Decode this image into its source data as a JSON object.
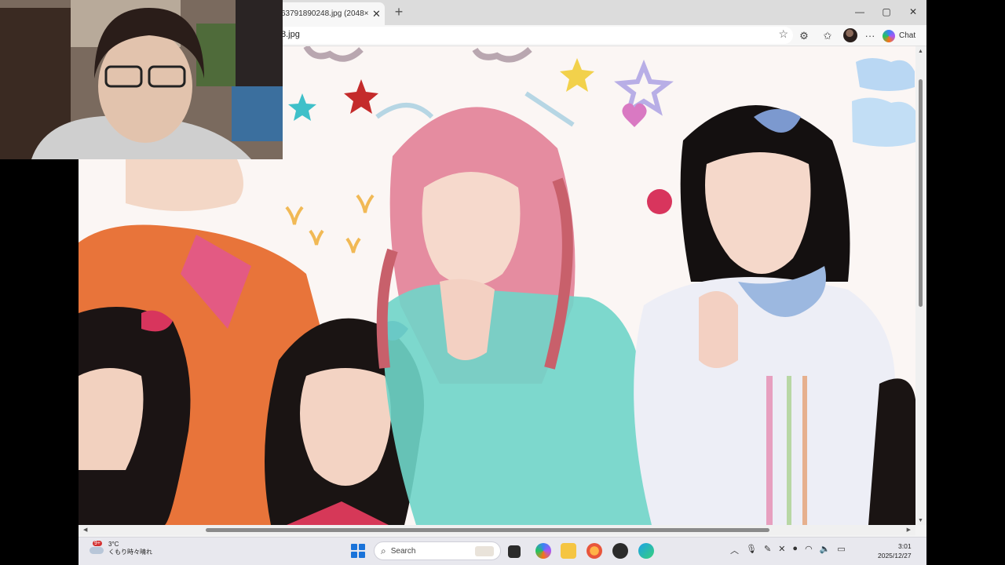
{
  "browser": {
    "tab_title": "63791890248.jpg (2048×16...",
    "tab_close": "✕",
    "new_tab": "+",
    "window_controls": {
      "minimize": "—",
      "maximize": "▢",
      "close": "✕"
    },
    "url": "8.jpg",
    "toolbar_icons": {
      "favorite": "☆",
      "extensions": "⚙",
      "favorites": "✩",
      "more": "···"
    },
    "copilot_label": "Chat"
  },
  "viewer": {
    "image_description_icons": [
      "star-icon",
      "heart-icon",
      "smiley-icon",
      "cloud-icon"
    ],
    "accent_colors": {
      "pink_hair": "#e58ca0",
      "teal_outfit": "#6fd5c9",
      "orange_outfit": "#e8743a",
      "background": "#fbf6f4"
    }
  },
  "taskbar": {
    "weather_badge": "9+",
    "weather_temp": "3°C",
    "weather_desc": "くもり時々晴れ",
    "search_placeholder": "Search",
    "clock_time": "3:01",
    "clock_date": "2025/12/27",
    "tray_icons": [
      "chevron-up-icon",
      "mic-icon",
      "pen-icon",
      "wifi-icon",
      "volume-icon",
      "battery-icon"
    ]
  }
}
